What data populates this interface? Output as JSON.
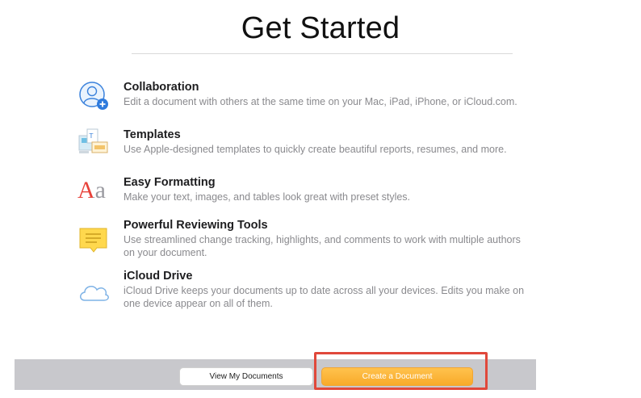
{
  "header": {
    "title": "Get Started"
  },
  "features": [
    {
      "icon": "collaboration-icon",
      "heading": "Collaboration",
      "desc_lines": [
        "Edit a document with others at the same time on your Mac, iPad, iPhone, or iCloud.com."
      ]
    },
    {
      "icon": "templates-icon",
      "heading": "Templates",
      "desc_lines": [
        "Use Apple-designed templates to quickly create beautiful reports, resumes, and more."
      ]
    },
    {
      "icon": "easy-formatting-icon",
      "heading": "Easy Formatting",
      "icon_text": "Aa",
      "desc_lines": [
        "Make your text, images, and tables look great with preset styles."
      ]
    },
    {
      "icon": "reviewing-tools-icon",
      "heading": "Powerful Reviewing Tools",
      "desc_lines": [
        "Use streamlined change tracking, highlights, and comments to work with multiple authors",
        "on your document."
      ]
    },
    {
      "icon": "icloud-drive-icon",
      "heading": "iCloud Drive",
      "desc_lines": [
        "iCloud Drive keeps your documents up to date across all your devices. Edits you make on",
        "one device appear on all of them."
      ]
    }
  ],
  "footer": {
    "view_label": "View My Documents",
    "create_label": "Create a Document"
  },
  "colors": {
    "accent": "#2f7bdd",
    "primary_button": "#f8aa2a",
    "highlight": "#e0483b",
    "reviewing_note": "#ffd84d",
    "formatting_A": "#e8423a"
  }
}
